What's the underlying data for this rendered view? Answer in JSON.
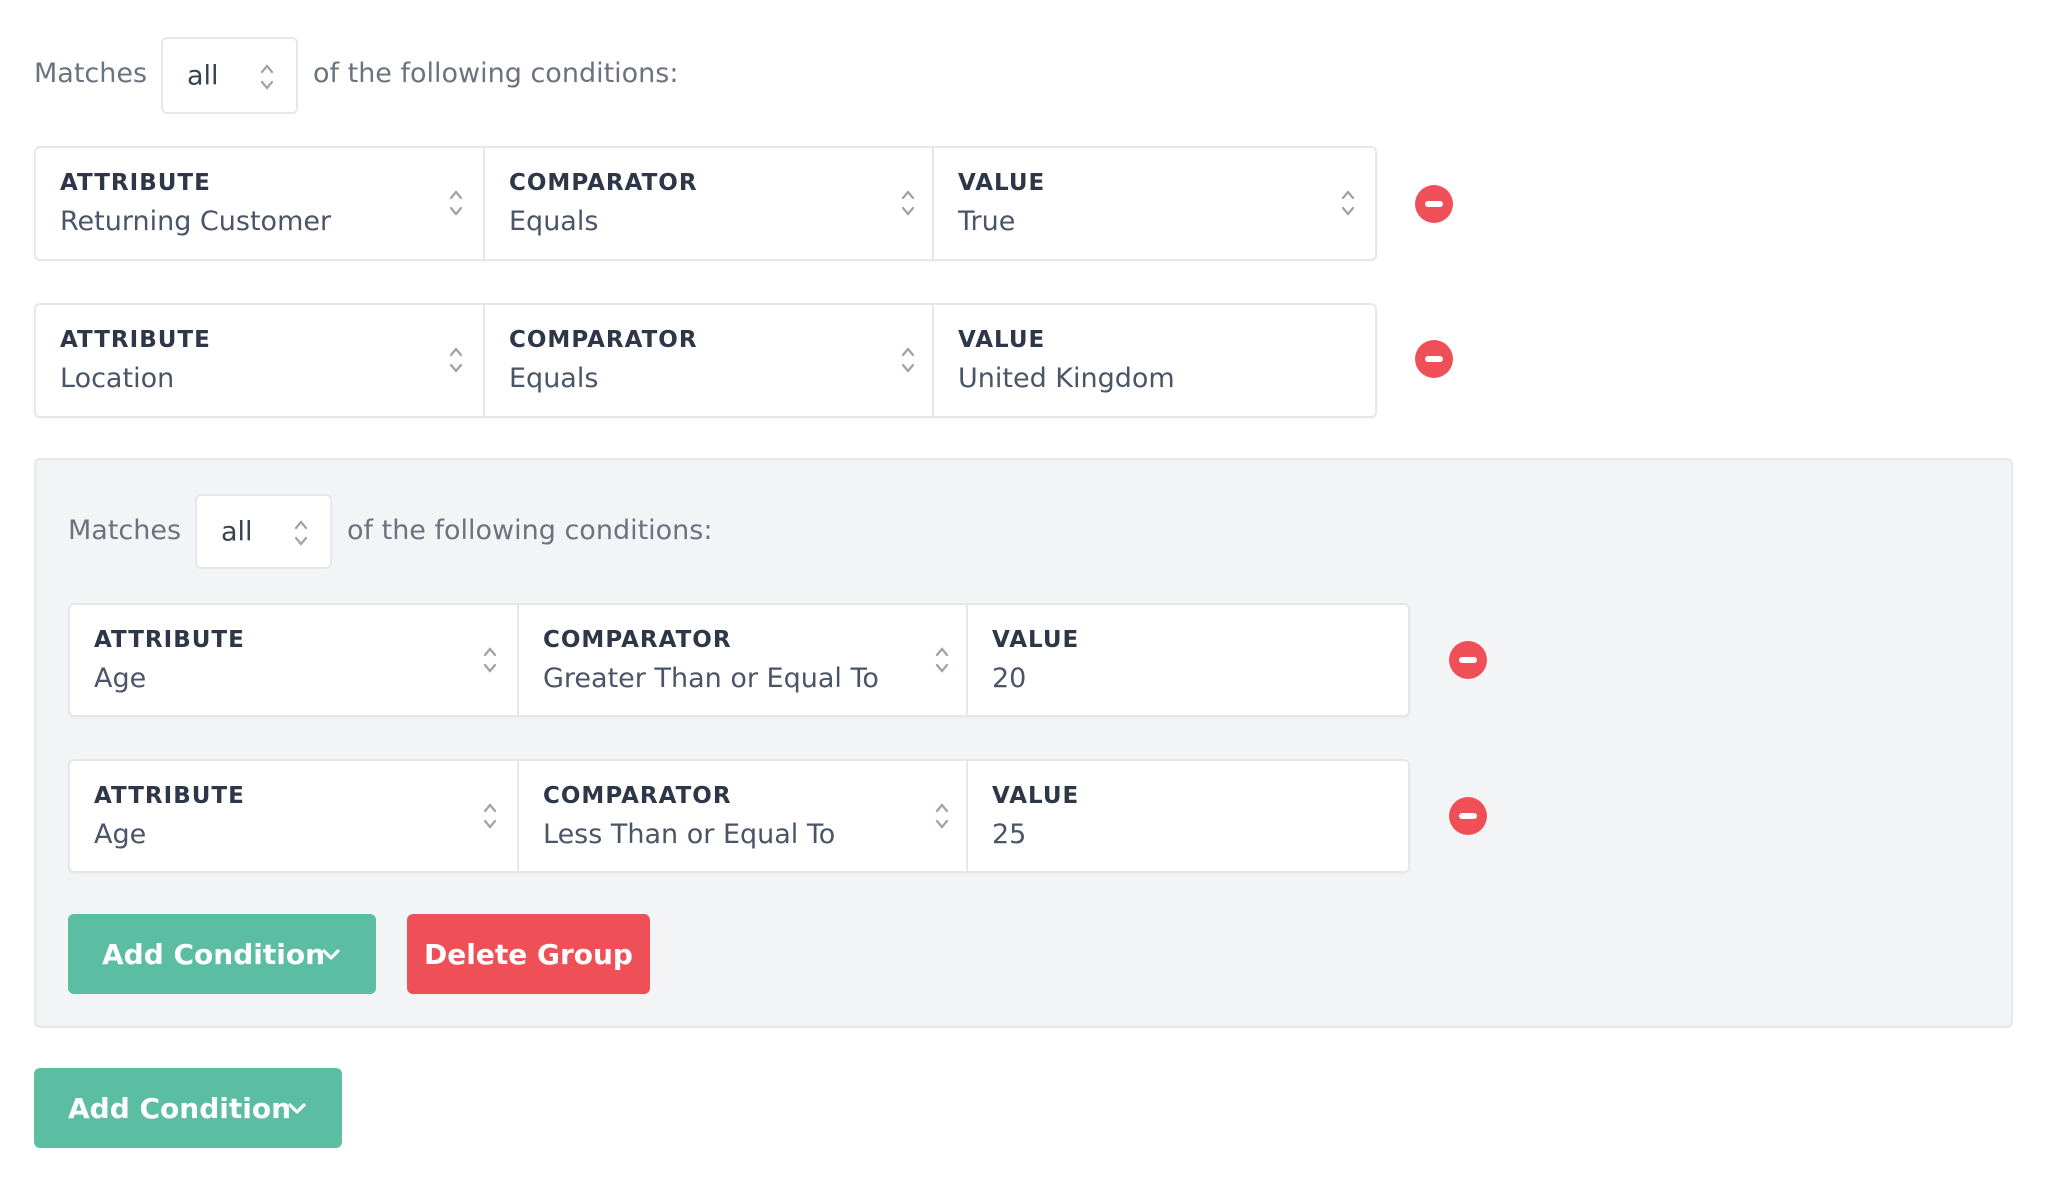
{
  "root": {
    "matches_label": "Matches",
    "match_mode": "all",
    "following_label": "of the following conditions:",
    "conditions": [
      {
        "attribute_label": "ATTRIBUTE",
        "attribute": "Returning Customer",
        "comparator_label": "COMPARATOR",
        "comparator": "Equals",
        "value_label": "VALUE",
        "value": "True",
        "value_is_select": true
      },
      {
        "attribute_label": "ATTRIBUTE",
        "attribute": "Location",
        "comparator_label": "COMPARATOR",
        "comparator": "Equals",
        "value_label": "VALUE",
        "value": "United Kingdom",
        "value_is_select": false
      }
    ],
    "add_condition_label": "Add Condition"
  },
  "group": {
    "matches_label": "Matches",
    "match_mode": "all",
    "following_label": "of the following conditions:",
    "conditions": [
      {
        "attribute_label": "ATTRIBUTE",
        "attribute": "Age",
        "comparator_label": "COMPARATOR",
        "comparator": "Greater Than or Equal To",
        "value_label": "VALUE",
        "value": "20",
        "value_is_select": false
      },
      {
        "attribute_label": "ATTRIBUTE",
        "attribute": "Age",
        "comparator_label": "COMPARATOR",
        "comparator": "Less Than or Equal To",
        "value_label": "VALUE",
        "value": "25",
        "value_is_select": false
      }
    ],
    "add_condition_label": "Add Condition",
    "delete_group_label": "Delete Group"
  },
  "icons": {
    "select": "chevron-up-down-icon",
    "remove": "minus-circle-icon",
    "dropdown": "chevron-down-icon"
  },
  "colors": {
    "primary": "#5bbda1",
    "danger": "#ef5058",
    "group_bg": "#f3f4f6",
    "border": "#e5e7eb"
  }
}
